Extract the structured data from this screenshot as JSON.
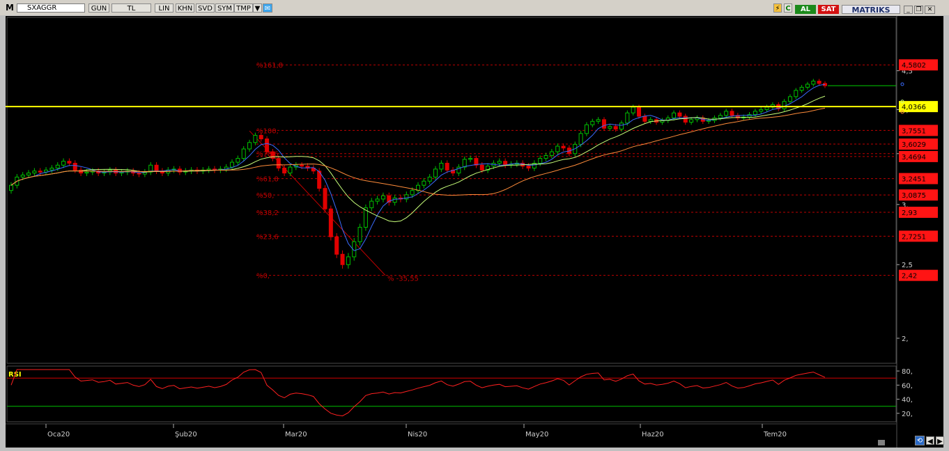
{
  "toolbar": {
    "logo": "M",
    "symbol": "SXAGGR",
    "buttons": [
      "GUN",
      "TL",
      "LIN",
      "KHN",
      "SVD",
      "SYM",
      "TMP"
    ],
    "buy_label": "AL",
    "sell_label": "SAT",
    "brand": "MATRIKS"
  },
  "colors": {
    "background": "#000000",
    "bull_candle": "#00c000",
    "bear_candle": "#e00000",
    "fib_line": "#c00000",
    "level_line": "#ffff00",
    "ma_fast": "#3a6cff",
    "ma_mid": "#c8ff7a",
    "ma_slow": "#ff8c3a",
    "rsi_line": "#ff2020"
  },
  "price_axis": {
    "ticks": [
      "2,",
      "2,5",
      "3,",
      "3,5",
      "4,",
      "4,5"
    ],
    "badges": [
      "4,5802",
      "4,0366",
      "3,7551",
      "3,6029",
      "3,4694",
      "3,2451",
      "3,0875",
      "2,93",
      "2,7251",
      "2,42"
    ]
  },
  "fibonacci": {
    "levels": [
      "%161,8",
      "%100,",
      "%78,6",
      "%61,8",
      "%50,",
      "%38,2",
      "%23,6",
      "%0,"
    ],
    "trend_label": "% -35,55"
  },
  "rsi": {
    "label": "RSI",
    "ticks": [
      "80,",
      "60,",
      "40,",
      "20,"
    ],
    "upper_band": 70,
    "lower_band": 30
  },
  "time_axis": {
    "labels": [
      "Oca20",
      "Şub20",
      "Mar20",
      "Nis20",
      "May20",
      "Haz20",
      "Tem20"
    ]
  },
  "chart_data": {
    "type": "candlestick",
    "symbol": "SXAGGR",
    "period": "daily",
    "close": [
      3.18,
      3.26,
      3.28,
      3.3,
      3.32,
      3.31,
      3.33,
      3.35,
      3.38,
      3.42,
      3.4,
      3.33,
      3.3,
      3.31,
      3.32,
      3.3,
      3.31,
      3.33,
      3.3,
      3.31,
      3.32,
      3.3,
      3.29,
      3.31,
      3.38,
      3.32,
      3.3,
      3.33,
      3.34,
      3.31,
      3.32,
      3.33,
      3.32,
      3.33,
      3.34,
      3.33,
      3.34,
      3.36,
      3.41,
      3.45,
      3.55,
      3.62,
      3.7,
      3.66,
      3.52,
      3.45,
      3.35,
      3.3,
      3.36,
      3.38,
      3.37,
      3.35,
      3.32,
      3.15,
      2.96,
      2.72,
      2.58,
      2.5,
      2.56,
      2.68,
      2.8,
      2.97,
      3.03,
      3.05,
      3.08,
      3.02,
      3.06,
      3.05,
      3.09,
      3.13,
      3.18,
      3.22,
      3.26,
      3.34,
      3.4,
      3.33,
      3.3,
      3.36,
      3.44,
      3.45,
      3.38,
      3.33,
      3.37,
      3.4,
      3.42,
      3.38,
      3.39,
      3.4,
      3.37,
      3.35,
      3.4,
      3.45,
      3.48,
      3.52,
      3.58,
      3.56,
      3.5,
      3.6,
      3.72,
      3.82,
      3.86,
      3.88,
      3.78,
      3.8,
      3.77,
      3.84,
      3.96,
      4.03,
      3.92,
      3.86,
      3.88,
      3.85,
      3.87,
      3.9,
      3.96,
      3.92,
      3.85,
      3.88,
      3.9,
      3.86,
      3.87,
      3.9,
      3.93,
      3.98,
      3.93,
      3.9,
      3.91,
      3.94,
      3.98,
      4.0,
      4.03,
      4.06,
      4.01,
      4.1,
      4.16,
      4.24,
      4.28,
      4.32,
      4.36,
      4.33,
      4.3
    ],
    "annotations": {
      "horizontal_level": 4.0366,
      "fibonacci_0": 2.42,
      "fibonacci_100": 3.7551,
      "fibonacci_161_8": 4.5802
    },
    "moving_averages": [
      "fast",
      "medium",
      "slow"
    ],
    "rsi_ylim": [
      10,
      85
    ]
  }
}
